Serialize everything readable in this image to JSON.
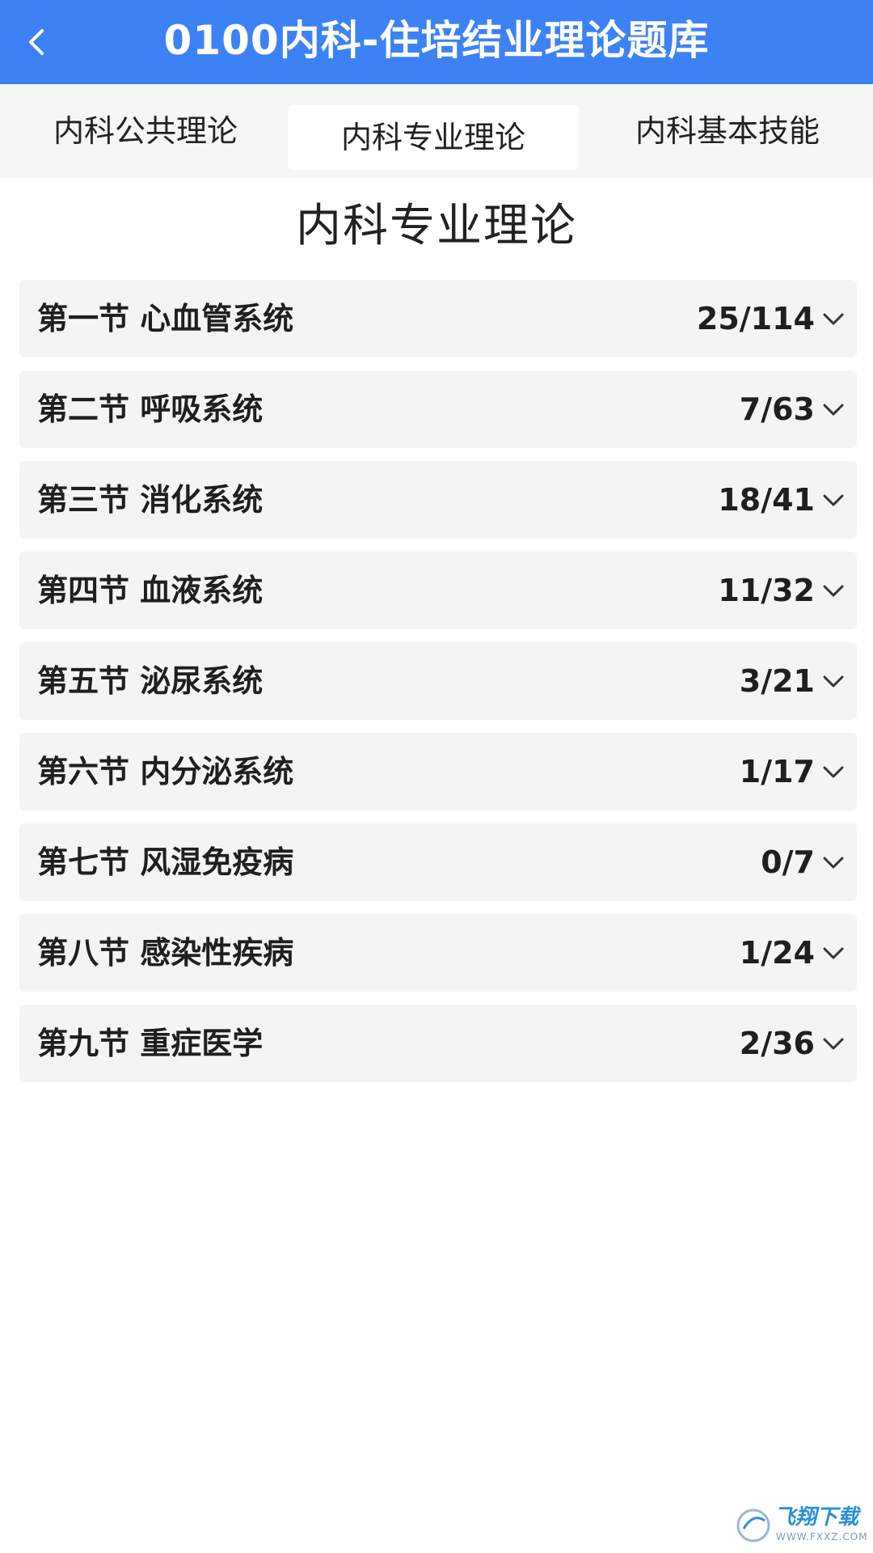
{
  "header": {
    "title": "0100内科-住培结业理论题库",
    "back_icon": "chevron-left-icon",
    "background_color": "#3d82f4"
  },
  "tabs": [
    {
      "label": "内科公共理论",
      "selected": false
    },
    {
      "label": "内科专业理论",
      "selected": true
    },
    {
      "label": "内科基本技能",
      "selected": false
    }
  ],
  "section_title": "内科专业理论",
  "sections": [
    {
      "title": "第一节 心血管系统",
      "count": "25/114"
    },
    {
      "title": "第二节 呼吸系统",
      "count": "7/63"
    },
    {
      "title": "第三节 消化系统",
      "count": "18/41"
    },
    {
      "title": "第四节 血液系统",
      "count": "11/32"
    },
    {
      "title": "第五节 泌尿系统",
      "count": "3/21"
    },
    {
      "title": "第六节 内分泌系统",
      "count": "1/17"
    },
    {
      "title": "第七节 风湿免疫病",
      "count": "0/7"
    },
    {
      "title": "第八节 感染性疾病",
      "count": "1/24"
    },
    {
      "title": "第九节 重症医学",
      "count": "2/36"
    }
  ],
  "watermark": {
    "text": "飞翔下载",
    "url": "WWW.FXXZ.COM"
  }
}
